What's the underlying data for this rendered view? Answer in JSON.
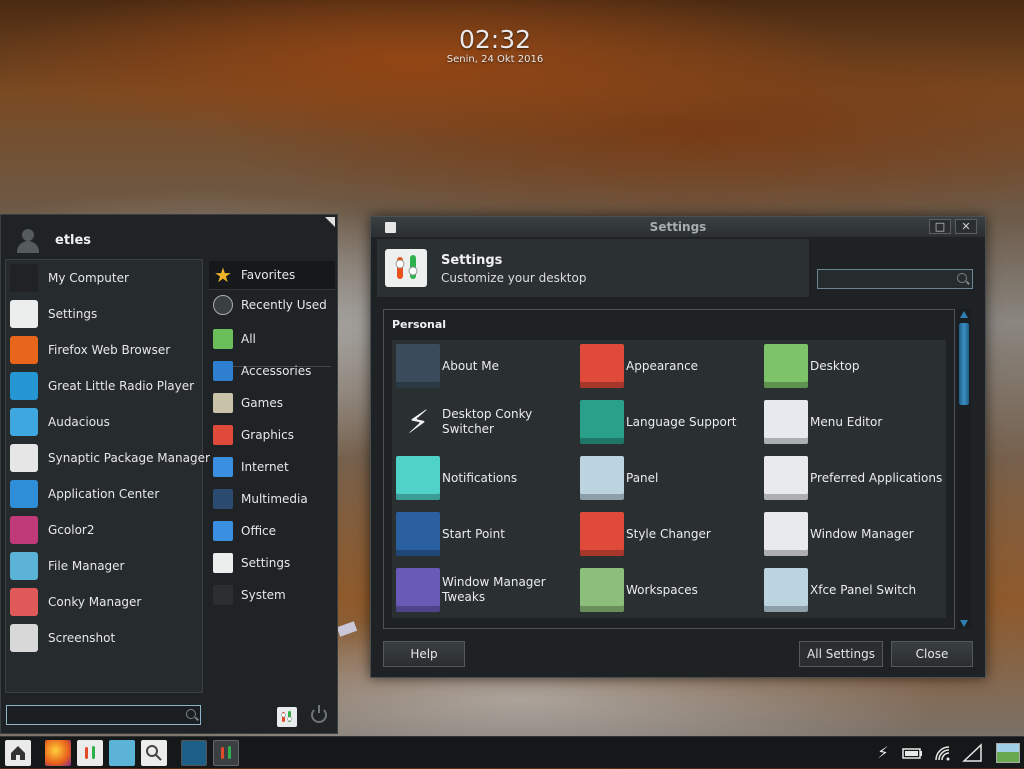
{
  "clock": {
    "time": "02:32",
    "date": "Senin, 24 Okt 2016"
  },
  "menu": {
    "username": "etles",
    "favorites": [
      {
        "label": "My Computer",
        "icon": "computer-icon",
        "color": "#202224"
      },
      {
        "label": "Settings",
        "icon": "settings-icon",
        "color": "#eceeee"
      },
      {
        "label": "Firefox Web Browser",
        "icon": "firefox-icon",
        "color": "#e8661c"
      },
      {
        "label": "Great Little Radio Player",
        "icon": "radio-icon",
        "color": "#2496d4"
      },
      {
        "label": "Audacious",
        "icon": "music-note-icon",
        "color": "#3ea7e0"
      },
      {
        "label": "Synaptic Package Manager",
        "icon": "package-download-icon",
        "color": "#e6e6e6"
      },
      {
        "label": "Application Center",
        "icon": "app-center-icon",
        "color": "#2e8fd8"
      },
      {
        "label": "Gcolor2",
        "icon": "color-wheel-icon",
        "color": "#c03a7a"
      },
      {
        "label": "File Manager",
        "icon": "folder-icon",
        "color": "#5bb3d8"
      },
      {
        "label": "Conky Manager",
        "icon": "conky-icon",
        "color": "#e05a5a"
      },
      {
        "label": "Screenshot",
        "icon": "camera-icon",
        "color": "#d8d8d8"
      }
    ],
    "categories": [
      {
        "label": "Favorites",
        "icon": "star-icon",
        "color": "#f0b42a"
      },
      {
        "label": "Recently Used",
        "icon": "clock-icon",
        "color": "#3a3f42"
      },
      {
        "label": "All",
        "icon": "landscape-icon",
        "color": "#6abf5a"
      },
      {
        "label": "Accessories",
        "icon": "accessories-icon",
        "color": "#2f7fd0"
      },
      {
        "label": "Games",
        "icon": "games-icon",
        "color": "#c7c2a8"
      },
      {
        "label": "Graphics",
        "icon": "graphics-icon",
        "color": "#e04a3a"
      },
      {
        "label": "Internet",
        "icon": "globe-icon",
        "color": "#3a8fe0"
      },
      {
        "label": "Multimedia",
        "icon": "multimedia-icon",
        "color": "#2a4a70"
      },
      {
        "label": "Office",
        "icon": "office-icon",
        "color": "#3a8fe0"
      },
      {
        "label": "Settings",
        "icon": "settings-icon",
        "color": "#eceeee"
      },
      {
        "label": "System",
        "icon": "system-list-icon",
        "color": "#2a2e30"
      }
    ],
    "search_placeholder": ""
  },
  "settings": {
    "window_title": "Settings",
    "header_title": "Settings",
    "header_subtitle": "Customize your desktop",
    "search_placeholder": "",
    "section": "Personal",
    "items": [
      {
        "label": "About Me",
        "icon": "user-icon",
        "color": "#3a4c5c"
      },
      {
        "label": "Appearance",
        "icon": "appearance-icon",
        "color": "#e04a3a"
      },
      {
        "label": "Desktop",
        "icon": "desktop-icon",
        "color": "#7dc36a"
      },
      {
        "label": "Desktop Conky Switcher",
        "icon": "lightning-icon",
        "color": "#2a2f31"
      },
      {
        "label": "Language Support",
        "icon": "flag-icon",
        "color": "#2aa08a"
      },
      {
        "label": "Menu Editor",
        "icon": "menu-editor-icon",
        "color": "#e6eaee"
      },
      {
        "label": "Notifications",
        "icon": "speech-bubble-icon",
        "color": "#4fd2c8"
      },
      {
        "label": "Panel",
        "icon": "panel-icon",
        "color": "#bcd4e0"
      },
      {
        "label": "Preferred Applications",
        "icon": "preferred-apps-icon",
        "color": "#e8eaec"
      },
      {
        "label": "Start Point",
        "icon": "play-icon",
        "color": "#2a5fa0"
      },
      {
        "label": "Style Changer",
        "icon": "style-icon",
        "color": "#e04a3a"
      },
      {
        "label": "Window Manager",
        "icon": "window-manager-icon",
        "color": "#e8eaec"
      },
      {
        "label": "Window Manager Tweaks",
        "label_line1": "Window Manager",
        "label_line2": "Tweaks",
        "icon": "wm-tweaks-icon",
        "color": "#6a5ab8"
      },
      {
        "label": "Workspaces",
        "icon": "workspaces-icon",
        "color": "#8cc07a"
      },
      {
        "label": "Xfce Panel Switch",
        "icon": "panel-switch-icon",
        "color": "#bcd4e0"
      }
    ],
    "help_label": "Help",
    "all_settings_label": "All Settings",
    "close_label": "Close"
  },
  "taskbar": {
    "items": [
      "home-icon",
      "firefox-icon",
      "settings-icon",
      "file-manager-icon",
      "search-app-icon",
      "radio-task-icon",
      "settings-task-icon"
    ],
    "tray": [
      "lightning-icon",
      "battery-icon",
      "wifi-icon",
      "signal-icon",
      "desktop-icon"
    ]
  }
}
